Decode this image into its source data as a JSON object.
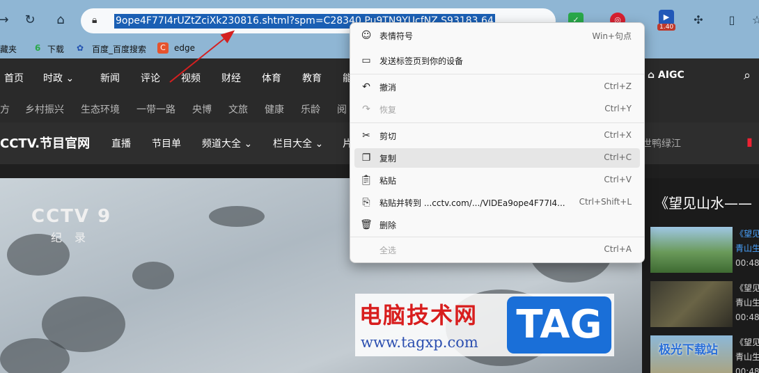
{
  "colors": {
    "accent": "#1a5fb4",
    "annotation_red": "#d42020",
    "site_bg": "#2a2a2a"
  },
  "address_bar": {
    "url": "9ope4F77I4rUZtZciXk230816.shtml?spm=C28340.Pu9TN9YUcfNZ.S93183.64"
  },
  "extensions": {
    "badge_count": "1.40"
  },
  "bookmarks": [
    {
      "label": "藏夹"
    },
    {
      "label": "下载"
    },
    {
      "label": "百度_百度搜索"
    },
    {
      "label": "edge"
    }
  ],
  "site_nav_main": [
    "首页",
    "时政",
    "新闻",
    "评论",
    "视频",
    "财经",
    "体育",
    "教育",
    "能"
  ],
  "site_nav_sub": [
    "方",
    "乡村振兴",
    "生态环境",
    "一带一路",
    "央博",
    "文旅",
    "健康",
    "乐龄",
    "阅"
  ],
  "site_nav_cctv": {
    "logo": "CCTV.节目官网",
    "items": [
      "直播",
      "节目单",
      "频道大全",
      "栏目大全",
      "片"
    ],
    "trailing": "世鸭绿江"
  },
  "aigc_label": "AIGC",
  "video": {
    "channel_logo": "CCTV 9",
    "channel_sub": "纪录"
  },
  "watermark": {
    "title": "电脑技术网",
    "url": "www.tagxp.com",
    "tag": "TAG"
  },
  "playlist": {
    "title": "《望见山水——",
    "items": [
      {
        "line1": "《望见",
        "line2": "青山生",
        "time": "00:48:"
      },
      {
        "line1": "《望见",
        "line2": "青山生",
        "time": "00:48:"
      },
      {
        "line1": "《望见",
        "line2": "青山生",
        "time": "00:48:"
      }
    ]
  },
  "corner_logo": "极光下载站",
  "context_menu": {
    "items": [
      {
        "label": "表情符号",
        "shortcut": "Win+句点"
      },
      {
        "label": "发送标签页到你的设备",
        "shortcut": ""
      },
      {
        "label": "撤消",
        "shortcut": "Ctrl+Z"
      },
      {
        "label": "恢复",
        "shortcut": "Ctrl+Y"
      },
      {
        "label": "剪切",
        "shortcut": "Ctrl+X"
      },
      {
        "label": "复制",
        "shortcut": "Ctrl+C"
      },
      {
        "label": "粘贴",
        "shortcut": "Ctrl+V"
      },
      {
        "label": "粘贴并转到 ...cctv.com/.../VIDEa9ope4F77I4...",
        "shortcut": "Ctrl+Shift+L"
      },
      {
        "label": "删除",
        "shortcut": ""
      },
      {
        "label": "全选",
        "shortcut": "Ctrl+A"
      }
    ]
  }
}
